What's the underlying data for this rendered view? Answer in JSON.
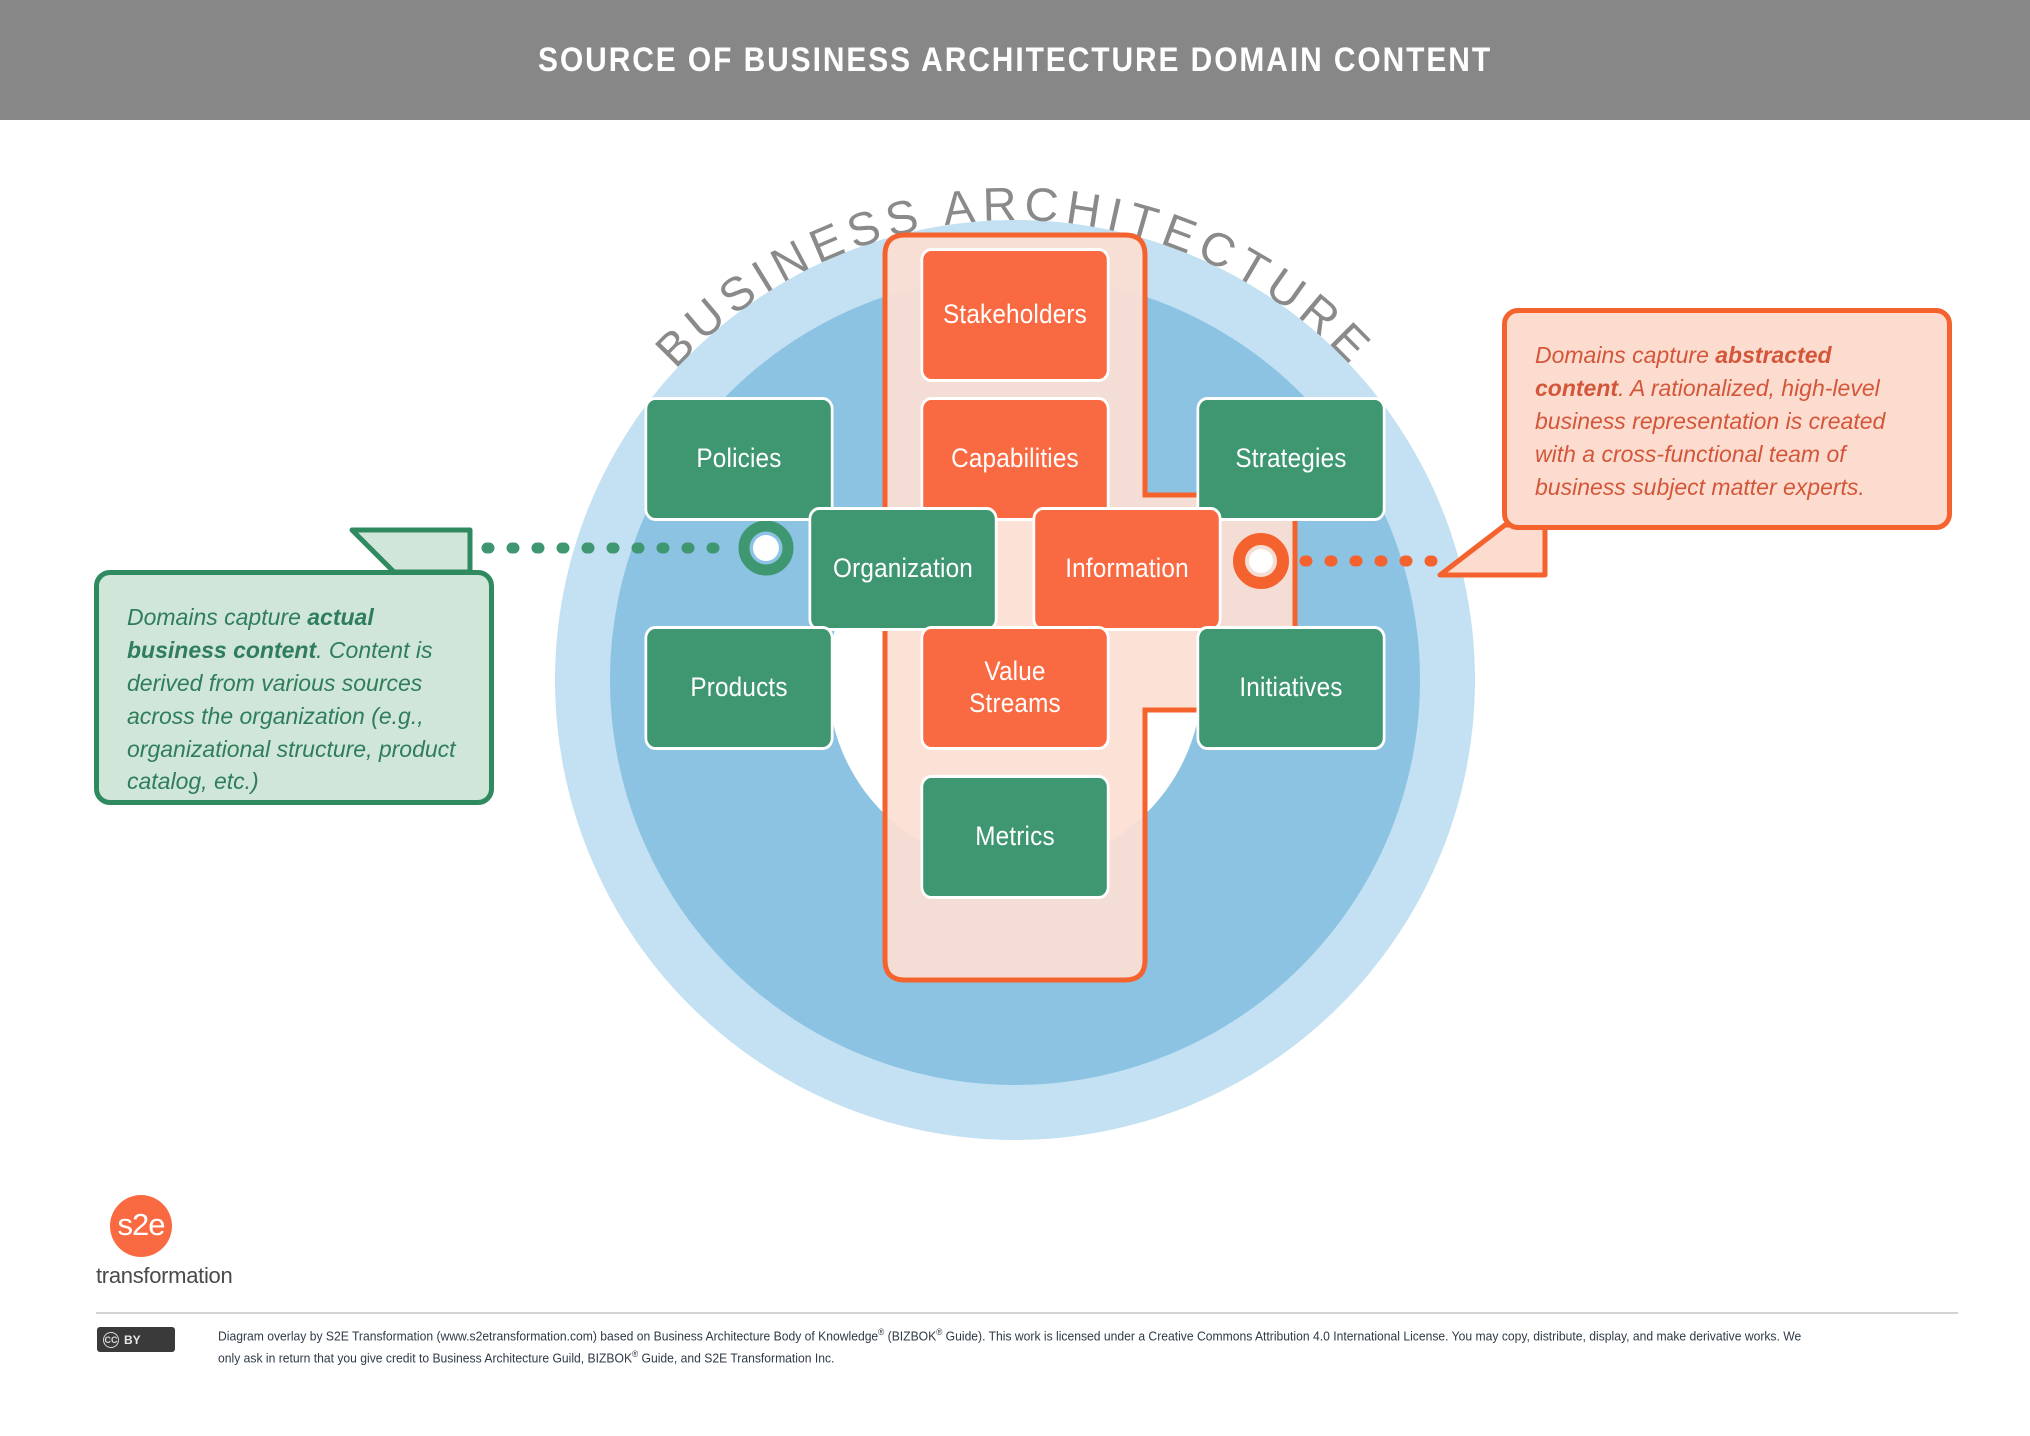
{
  "header": {
    "title": "SOURCE OF BUSINESS ARCHITECTURE DOMAIN CONTENT"
  },
  "diagram": {
    "ring_label": "BUSINESS ARCHITECTURE",
    "domains": [
      {
        "label": "Stakeholders",
        "type": "orange"
      },
      {
        "label": "Policies",
        "type": "green"
      },
      {
        "label": "Capabilities",
        "type": "orange"
      },
      {
        "label": "Strategies",
        "type": "green"
      },
      {
        "label": "Organization",
        "type": "green"
      },
      {
        "label": "Information",
        "type": "orange"
      },
      {
        "label": "Products",
        "type": "green"
      },
      {
        "label": "Value Streams",
        "type": "orange",
        "line1": "Value",
        "line2": "Streams"
      },
      {
        "label": "Initiatives",
        "type": "green"
      },
      {
        "label": "Metrics",
        "type": "green"
      }
    ]
  },
  "callouts": {
    "left": {
      "lead": "Domains capture ",
      "bold": "actual business content",
      "rest": ". Content is derived from various sources across the organization (e.g., organizational structure, product catalog, etc.)"
    },
    "right": {
      "lead": "Domains capture ",
      "bold": "abstracted content",
      "rest": ". A rationalized, high-level business representation is created with a cross-functional team of business subject matter experts."
    }
  },
  "logo": {
    "mark": "s2e",
    "word": "transformation"
  },
  "footer": {
    "license_badge_cc": "CC",
    "license_badge_by": "BY",
    "credit_part1": "Diagram overlay by S2E Transformation (www.s2etransformation.com) based on Business Architecture Body of Knowledge",
    "credit_sup1": "®",
    "credit_part2": " (BIZBOK",
    "credit_sup2": "®",
    "credit_part3": " Guide). This work is licensed under a Creative Commons Attribution 4.0 International License. You may copy, distribute, display, and make derivative works. We only ask in return that you give credit to Business Architecture Guild, BIZBOK",
    "credit_sup3": "®",
    "credit_part4": " Guide, and S2E Transformation Inc."
  },
  "colors": {
    "header_bg": "#878787",
    "ring_outer": "#c3e1f2",
    "ring_inner": "#8cc3e3",
    "core_white": "#ffffff",
    "cross_fill": "#fcdfd3",
    "cross_stroke": "#f4622e",
    "green": "#3f9772",
    "orange": "#fa6a42",
    "ring_label": "#8a8a8a"
  }
}
